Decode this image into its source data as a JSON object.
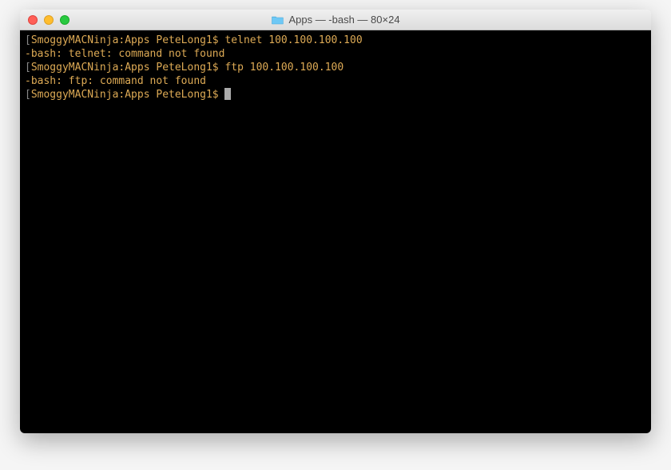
{
  "window": {
    "title": "Apps — -bash — 80×24"
  },
  "terminal": {
    "lines": [
      {
        "bracket_open": "[",
        "prompt": "SmoggyMACNinja:Apps PeteLong1$ ",
        "command": "telnet 100.100.100.100"
      },
      {
        "text": "-bash: telnet: command not found"
      },
      {
        "bracket_open": "[",
        "prompt": "SmoggyMACNinja:Apps PeteLong1$ ",
        "command": "ftp 100.100.100.100"
      },
      {
        "text": "-bash: ftp: command not found"
      },
      {
        "bracket_open": "[",
        "prompt": "SmoggyMACNinja:Apps PeteLong1$ ",
        "command": ""
      }
    ]
  }
}
